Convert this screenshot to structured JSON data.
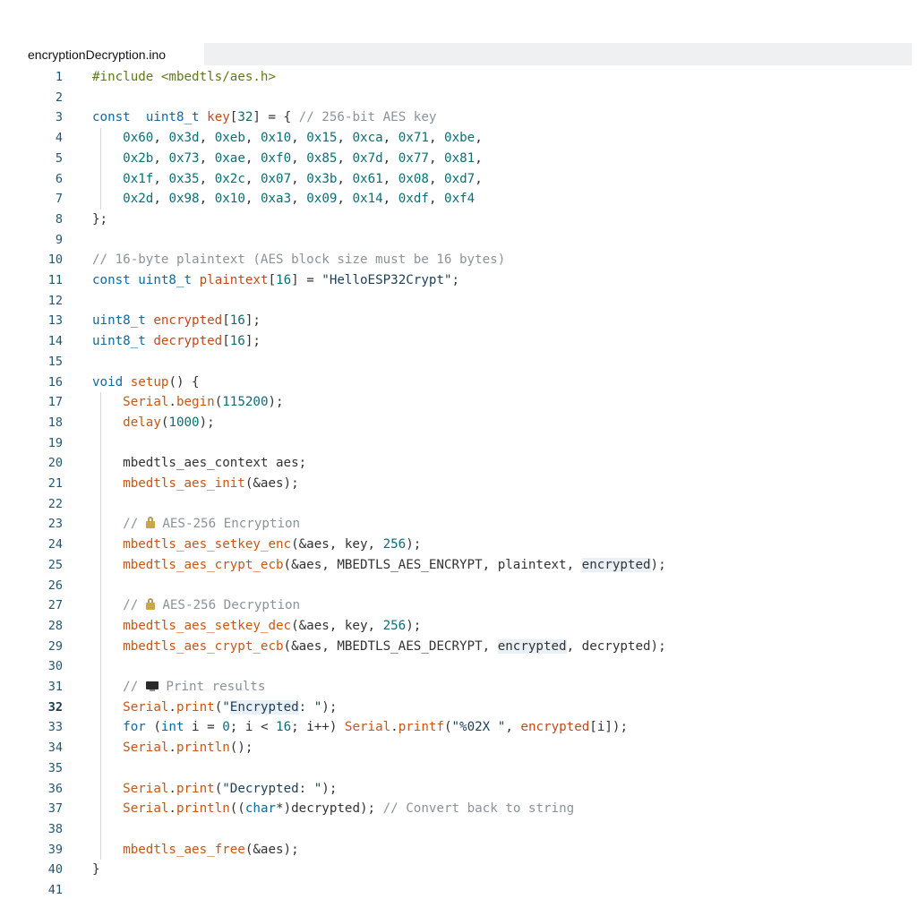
{
  "tab": {
    "filename": "encryptionDecryption.ino"
  },
  "editor": {
    "active_line": 32,
    "lines": [
      {
        "n": "1",
        "segs": [
          [
            "pp",
            "#include <mbedtls/aes.h>"
          ]
        ]
      },
      {
        "n": "2",
        "segs": []
      },
      {
        "n": "3",
        "segs": [
          [
            "kw",
            "const"
          ],
          [
            "",
            "  "
          ],
          [
            "kw",
            "uint8_t"
          ],
          [
            "",
            " "
          ],
          [
            "var",
            "key"
          ],
          [
            "",
            "["
          ],
          [
            "num",
            "32"
          ],
          [
            "",
            "] = { "
          ],
          [
            "cm",
            "// 256-bit AES key"
          ]
        ]
      },
      {
        "n": "4",
        "segs": [
          [
            "",
            "    "
          ],
          [
            "num",
            "0x60"
          ],
          [
            ", ",
            ""
          ],
          [
            "num",
            "0x3d"
          ],
          [
            "",
            ", "
          ],
          [
            "num",
            "0xeb"
          ],
          [
            "",
            ", "
          ],
          [
            "num",
            "0x10"
          ],
          [
            "",
            ", "
          ],
          [
            "num",
            "0x15"
          ],
          [
            "",
            ", "
          ],
          [
            "num",
            "0xca"
          ],
          [
            "",
            ", "
          ],
          [
            "num",
            "0x71"
          ],
          [
            "",
            ", "
          ],
          [
            "num",
            "0xbe"
          ],
          [
            "",
            ","
          ]
        ]
      },
      {
        "n": "5",
        "segs": [
          [
            "",
            "    "
          ],
          [
            "num",
            "0x2b"
          ],
          [
            "",
            ", "
          ],
          [
            "num",
            "0x73"
          ],
          [
            "",
            ", "
          ],
          [
            "num",
            "0xae"
          ],
          [
            "",
            ", "
          ],
          [
            "num",
            "0xf0"
          ],
          [
            "",
            ", "
          ],
          [
            "num",
            "0x85"
          ],
          [
            "",
            ", "
          ],
          [
            "num",
            "0x7d"
          ],
          [
            "",
            ", "
          ],
          [
            "num",
            "0x77"
          ],
          [
            "",
            ", "
          ],
          [
            "num",
            "0x81"
          ],
          [
            "",
            ","
          ]
        ]
      },
      {
        "n": "6",
        "segs": [
          [
            "",
            "    "
          ],
          [
            "num",
            "0x1f"
          ],
          [
            "",
            ", "
          ],
          [
            "num",
            "0x35"
          ],
          [
            "",
            ", "
          ],
          [
            "num",
            "0x2c"
          ],
          [
            "",
            ", "
          ],
          [
            "num",
            "0x07"
          ],
          [
            "",
            ", "
          ],
          [
            "num",
            "0x3b"
          ],
          [
            "",
            ", "
          ],
          [
            "num",
            "0x61"
          ],
          [
            "",
            ", "
          ],
          [
            "num",
            "0x08"
          ],
          [
            "",
            ", "
          ],
          [
            "num",
            "0xd7"
          ],
          [
            "",
            ","
          ]
        ]
      },
      {
        "n": "7",
        "segs": [
          [
            "",
            "    "
          ],
          [
            "num",
            "0x2d"
          ],
          [
            "",
            ", "
          ],
          [
            "num",
            "0x98"
          ],
          [
            "",
            ", "
          ],
          [
            "num",
            "0x10"
          ],
          [
            "",
            ", "
          ],
          [
            "num",
            "0xa3"
          ],
          [
            "",
            ", "
          ],
          [
            "num",
            "0x09"
          ],
          [
            "",
            ", "
          ],
          [
            "num",
            "0x14"
          ],
          [
            "",
            ", "
          ],
          [
            "num",
            "0xdf"
          ],
          [
            "",
            ", "
          ],
          [
            "num",
            "0xf4"
          ]
        ]
      },
      {
        "n": "8",
        "segs": [
          [
            "",
            "};"
          ]
        ]
      },
      {
        "n": "9",
        "segs": []
      },
      {
        "n": "10",
        "segs": [
          [
            "cm",
            "// 16-byte plaintext (AES block size must be 16 bytes)"
          ]
        ]
      },
      {
        "n": "11",
        "segs": [
          [
            "kw",
            "const"
          ],
          [
            "",
            " "
          ],
          [
            "kw",
            "uint8_t"
          ],
          [
            "",
            " "
          ],
          [
            "var",
            "plaintext"
          ],
          [
            "",
            "["
          ],
          [
            "num",
            "16"
          ],
          [
            "",
            "] = "
          ],
          [
            "str",
            "\"HelloESP32Crypt\""
          ],
          [
            "",
            ";"
          ]
        ]
      },
      {
        "n": "12",
        "segs": []
      },
      {
        "n": "13",
        "segs": [
          [
            "kw",
            "uint8_t"
          ],
          [
            "",
            " "
          ],
          [
            "var",
            "encrypted"
          ],
          [
            "",
            "["
          ],
          [
            "num",
            "16"
          ],
          [
            "",
            "];"
          ]
        ]
      },
      {
        "n": "14",
        "segs": [
          [
            "kw",
            "uint8_t"
          ],
          [
            "",
            " "
          ],
          [
            "var",
            "decrypted"
          ],
          [
            "",
            "["
          ],
          [
            "num",
            "16"
          ],
          [
            "",
            "];"
          ]
        ]
      },
      {
        "n": "15",
        "segs": []
      },
      {
        "n": "16",
        "segs": [
          [
            "kw",
            "void"
          ],
          [
            "",
            " "
          ],
          [
            "fn",
            "setup"
          ],
          [
            "",
            "() {"
          ]
        ]
      },
      {
        "n": "17",
        "segs": [
          [
            "",
            "    "
          ],
          [
            "fn",
            "Serial"
          ],
          [
            "",
            "."
          ],
          [
            "fn",
            "begin"
          ],
          [
            "",
            "("
          ],
          [
            "num",
            "115200"
          ],
          [
            "",
            ");"
          ]
        ]
      },
      {
        "n": "18",
        "segs": [
          [
            "",
            "    "
          ],
          [
            "fn",
            "delay"
          ],
          [
            "",
            "("
          ],
          [
            "num",
            "1000"
          ],
          [
            "",
            ");"
          ]
        ]
      },
      {
        "n": "19",
        "segs": []
      },
      {
        "n": "20",
        "segs": [
          [
            "",
            "    mbedtls_aes_context aes;"
          ]
        ]
      },
      {
        "n": "21",
        "segs": [
          [
            "",
            "    "
          ],
          [
            "fn",
            "mbedtls_aes_init"
          ],
          [
            "",
            "(&aes);"
          ]
        ]
      },
      {
        "n": "22",
        "segs": []
      },
      {
        "n": "23",
        "segs": [
          [
            "",
            "    "
          ],
          [
            "cm",
            "// "
          ],
          [
            "lock",
            ""
          ],
          [
            "cm",
            " AES-256 Encryption"
          ]
        ]
      },
      {
        "n": "24",
        "segs": [
          [
            "",
            "    "
          ],
          [
            "fn",
            "mbedtls_aes_setkey_enc"
          ],
          [
            "",
            "(&aes, key, "
          ],
          [
            "num",
            "256"
          ],
          [
            "",
            ");"
          ]
        ]
      },
      {
        "n": "25",
        "segs": [
          [
            "",
            "    "
          ],
          [
            "fn",
            "mbedtls_aes_crypt_ecb"
          ],
          [
            "",
            "(&aes, MBEDTLS_AES_ENCRYPT, plaintext, "
          ],
          [
            "hl",
            "encrypted"
          ],
          [
            "",
            ");"
          ]
        ]
      },
      {
        "n": "26",
        "segs": []
      },
      {
        "n": "27",
        "segs": [
          [
            "",
            "    "
          ],
          [
            "cm",
            "// "
          ],
          [
            "lock",
            ""
          ],
          [
            "cm",
            " AES-256 Decryption"
          ]
        ]
      },
      {
        "n": "28",
        "segs": [
          [
            "",
            "    "
          ],
          [
            "fn",
            "mbedtls_aes_setkey_dec"
          ],
          [
            "",
            "(&aes, key, "
          ],
          [
            "num",
            "256"
          ],
          [
            "",
            ");"
          ]
        ]
      },
      {
        "n": "29",
        "segs": [
          [
            "",
            "    "
          ],
          [
            "fn",
            "mbedtls_aes_crypt_ecb"
          ],
          [
            "",
            "(&aes, MBEDTLS_AES_DECRYPT, "
          ],
          [
            "hl",
            "encrypted"
          ],
          [
            "",
            ", decrypted);"
          ]
        ]
      },
      {
        "n": "30",
        "segs": []
      },
      {
        "n": "31",
        "segs": [
          [
            "",
            "    "
          ],
          [
            "cm",
            "// "
          ],
          [
            "monitor",
            ""
          ],
          [
            "cm",
            " Print results"
          ]
        ]
      },
      {
        "n": "32",
        "segs": [
          [
            "",
            "    "
          ],
          [
            "fn",
            "Serial"
          ],
          [
            "",
            "."
          ],
          [
            "fn",
            "print"
          ],
          [
            "",
            "("
          ],
          [
            "str",
            "\""
          ],
          [
            "hlstr",
            "Encrypted"
          ],
          [
            "str",
            ": \""
          ],
          [
            "",
            ");"
          ]
        ]
      },
      {
        "n": "33",
        "segs": [
          [
            "",
            "    "
          ],
          [
            "kw",
            "for"
          ],
          [
            "",
            " ("
          ],
          [
            "kw",
            "int"
          ],
          [
            "",
            " i = "
          ],
          [
            "num",
            "0"
          ],
          [
            "",
            "; i < "
          ],
          [
            "num",
            "16"
          ],
          [
            "",
            "; i++) "
          ],
          [
            "fn",
            "Serial"
          ],
          [
            "",
            "."
          ],
          [
            "fn",
            "printf"
          ],
          [
            "",
            "("
          ],
          [
            "str",
            "\"%02X \""
          ],
          [
            "",
            ", "
          ],
          [
            "var",
            "encrypted"
          ],
          [
            "",
            "[i]);"
          ]
        ]
      },
      {
        "n": "34",
        "segs": [
          [
            "",
            "    "
          ],
          [
            "fn",
            "Serial"
          ],
          [
            "",
            "."
          ],
          [
            "fn",
            "println"
          ],
          [
            "",
            "();"
          ]
        ]
      },
      {
        "n": "35",
        "segs": []
      },
      {
        "n": "36",
        "segs": [
          [
            "",
            "    "
          ],
          [
            "fn",
            "Serial"
          ],
          [
            "",
            "."
          ],
          [
            "fn",
            "print"
          ],
          [
            "",
            "("
          ],
          [
            "str",
            "\"Decrypted: \""
          ],
          [
            "",
            ");"
          ]
        ]
      },
      {
        "n": "37",
        "segs": [
          [
            "",
            "    "
          ],
          [
            "fn",
            "Serial"
          ],
          [
            "",
            "."
          ],
          [
            "fn",
            "println"
          ],
          [
            "",
            "(("
          ],
          [
            "kw",
            "char"
          ],
          [
            "",
            "*)decrypted); "
          ],
          [
            "cm",
            "// Convert back to string"
          ]
        ]
      },
      {
        "n": "38",
        "segs": []
      },
      {
        "n": "39",
        "segs": [
          [
            "",
            "    "
          ],
          [
            "fn",
            "mbedtls_aes_free"
          ],
          [
            "",
            "(&aes);"
          ]
        ]
      },
      {
        "n": "40",
        "segs": [
          [
            "",
            "}"
          ]
        ]
      },
      {
        "n": "41",
        "segs": []
      }
    ]
  }
}
